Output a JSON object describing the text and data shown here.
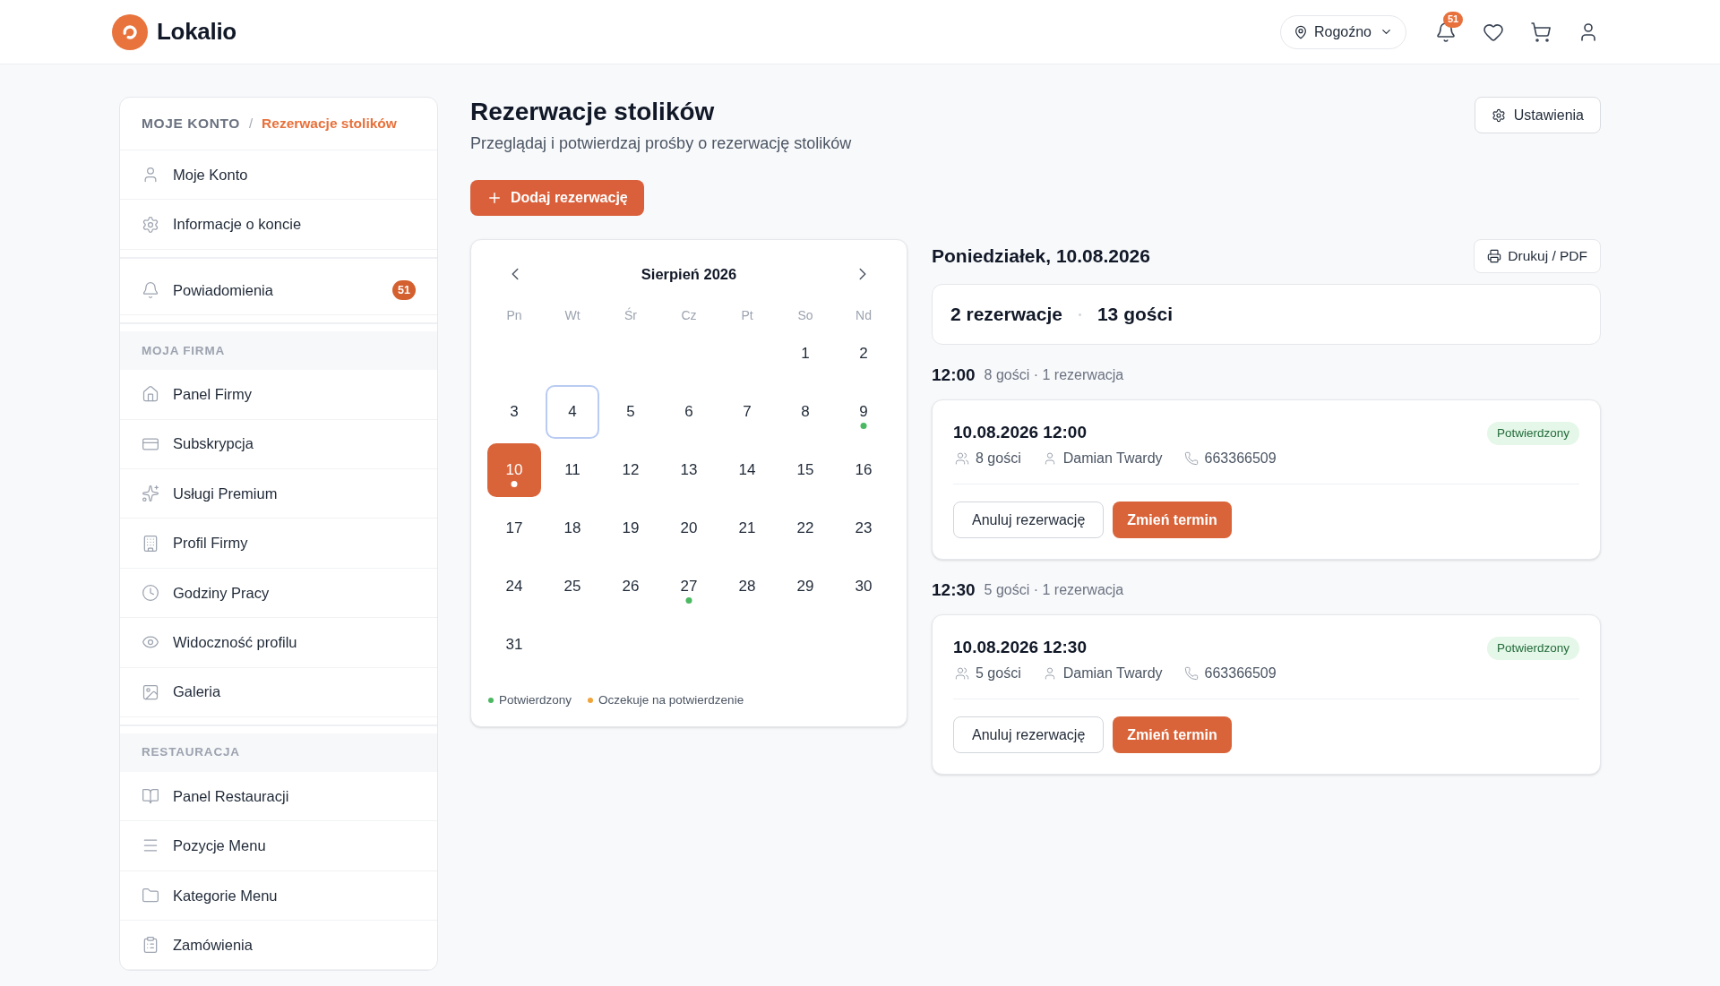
{
  "header": {
    "brand": "Lokalio",
    "location": "Rogoźno",
    "notification_count": "51"
  },
  "sidebar": {
    "breadcrumb": {
      "root": "MOJE KONTO",
      "separator": "/",
      "current": "Rezerwacje stolików"
    },
    "groups": [
      {
        "items": [
          {
            "label": "Moje Konto"
          },
          {
            "label": "Informacje o koncie"
          }
        ]
      },
      {
        "items": [
          {
            "label": "Powiadomienia",
            "badge": "51"
          }
        ]
      },
      {
        "heading": "MOJA FIRMA",
        "items": [
          {
            "label": "Panel Firmy"
          },
          {
            "label": "Subskrypcja"
          },
          {
            "label": "Usługi Premium"
          },
          {
            "label": "Profil Firmy"
          },
          {
            "label": "Godziny Pracy"
          },
          {
            "label": "Widoczność profilu"
          },
          {
            "label": "Galeria"
          }
        ]
      },
      {
        "heading": "RESTAURACJA",
        "items": [
          {
            "label": "Panel Restauracji"
          },
          {
            "label": "Pozycje Menu"
          },
          {
            "label": "Kategorie Menu"
          },
          {
            "label": "Zamówienia"
          }
        ]
      }
    ]
  },
  "page": {
    "title": "Rezerwacje stolików",
    "subtitle": "Przeglądaj i potwierdzaj prośby o rezerwację stolików",
    "add_button": "Dodaj rezerwację",
    "settings_button": "Ustawienia"
  },
  "calendar": {
    "month": "Sierpień 2026",
    "weekdays": [
      "Pn",
      "Wt",
      "Śr",
      "Cz",
      "Pt",
      "So",
      "Nd"
    ],
    "weeks": [
      [
        {
          "day": "1",
          "selected": false,
          "today": false
        },
        {
          "day": "2",
          "selected": false,
          "today": false
        }
      ],
      [
        {
          "day": "3",
          "selected": false,
          "today": false
        },
        {
          "day": "4",
          "selected": false,
          "today": true
        },
        {
          "day": "5",
          "selected": false,
          "today": false
        },
        {
          "day": "6",
          "selected": false,
          "today": false
        },
        {
          "day": "7",
          "selected": false,
          "today": false
        },
        {
          "day": "8",
          "selected": false,
          "today": false
        },
        {
          "day": "9",
          "selected": false,
          "today": false,
          "color": "#4bb862"
        }
      ],
      [
        {
          "day": "10",
          "selected": true,
          "today": false,
          "color": "#ffffff"
        },
        {
          "day": "11",
          "selected": false,
          "today": false
        },
        {
          "day": "12",
          "selected": false,
          "today": false
        },
        {
          "day": "13",
          "selected": false,
          "today": false
        },
        {
          "day": "14",
          "selected": false,
          "today": false
        },
        {
          "day": "15",
          "selected": false,
          "today": false
        },
        {
          "day": "16",
          "selected": false,
          "today": false
        }
      ],
      [
        {
          "day": "17",
          "selected": false,
          "today": false
        },
        {
          "day": "18",
          "selected": false,
          "today": false
        },
        {
          "day": "19",
          "selected": false,
          "today": false
        },
        {
          "day": "20",
          "selected": false,
          "today": false
        },
        {
          "day": "21",
          "selected": false,
          "today": false
        },
        {
          "day": "22",
          "selected": false,
          "today": false
        },
        {
          "day": "23",
          "selected": false,
          "today": false
        }
      ],
      [
        {
          "day": "24",
          "selected": false,
          "today": false
        },
        {
          "day": "25",
          "selected": false,
          "today": false
        },
        {
          "day": "26",
          "selected": false,
          "today": false
        },
        {
          "day": "27",
          "selected": false,
          "today": false,
          "color": "#4bb862"
        },
        {
          "day": "28",
          "selected": false,
          "today": false
        },
        {
          "day": "29",
          "selected": false,
          "today": false
        },
        {
          "day": "30",
          "selected": false,
          "today": false
        }
      ],
      [
        {
          "day": "31",
          "selected": false,
          "today": false
        }
      ]
    ],
    "legend": [
      {
        "label": "Potwierdzony",
        "color": "#4bb862"
      },
      {
        "label": "Oczekuje na potwierdzenie",
        "color": "#f0a43a"
      }
    ]
  },
  "day_panel": {
    "title": "Poniedziałek, 10.08.2026",
    "print_button": "Drukuj / PDF",
    "summary": {
      "reservations": "2 rezerwacje",
      "guests": "13 gości"
    },
    "slots": [
      {
        "time": "12:00",
        "meta": "8 gości · 1 rezerwacja",
        "reservations": [
          {
            "datetime": "10.08.2026 12:00",
            "status": "Potwierdzony",
            "guests": "8 gości",
            "name": "Damian Twardy",
            "phone": "663366509",
            "cancel_button": "Anuluj rezerwację",
            "reschedule_button": "Zmień termin"
          }
        ]
      },
      {
        "time": "12:30",
        "meta": "5 gości · 1 rezerwacja",
        "reservations": [
          {
            "datetime": "10.08.2026 12:30",
            "status": "Potwierdzony",
            "guests": "5 gości",
            "name": "Damian Twardy",
            "phone": "663366509",
            "cancel_button": "Anuluj rezerwację",
            "reschedule_button": "Zmień termin"
          }
        ]
      }
    ]
  }
}
